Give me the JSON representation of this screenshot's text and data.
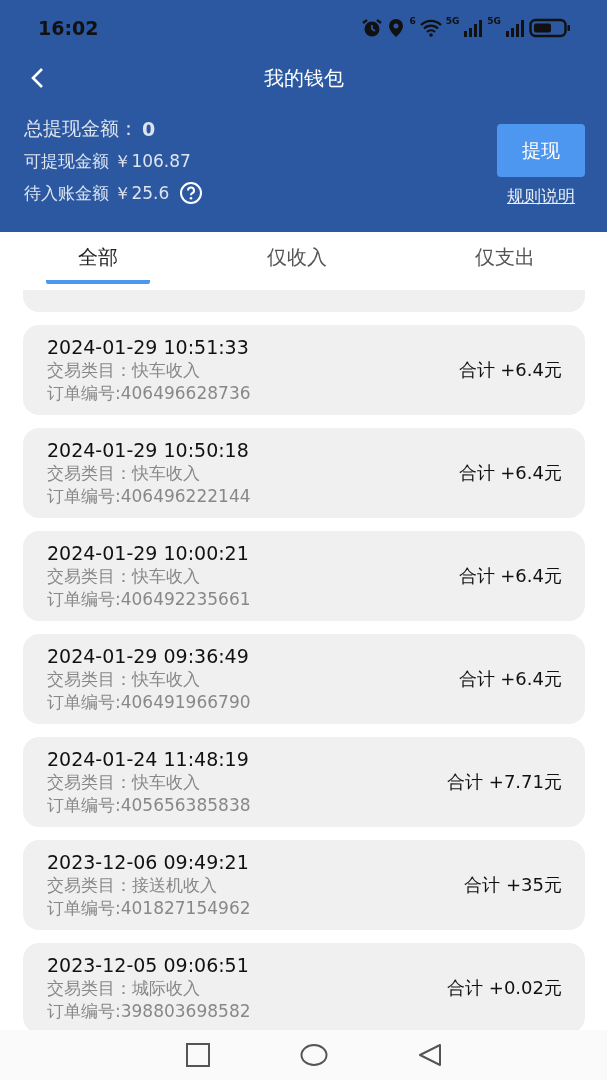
{
  "status_bar": {
    "time": "16:02",
    "wifi_label": "6",
    "sim1_label": "5G",
    "sim2_label": "5G"
  },
  "header": {
    "title": "我的钱包"
  },
  "summary": {
    "total_label": "总提现金额：",
    "total_value": "0",
    "available": "可提现金额 ￥106.87",
    "pending": "待入账金额 ￥25.6"
  },
  "withdraw_button": "提现",
  "rules_link": "规则说明",
  "tabs": [
    {
      "label": "全部",
      "selected": true
    },
    {
      "label": "仅收入",
      "selected": false
    },
    {
      "label": "仅支出",
      "selected": false
    }
  ],
  "transactions": [
    {
      "time": "2024-01-29 10:51:33",
      "category": "交易类目：快车收入",
      "order": "订单编号:406496628736",
      "total": "合计 +6.4元"
    },
    {
      "time": "2024-01-29 10:50:18",
      "category": "交易类目：快车收入",
      "order": "订单编号:406496222144",
      "total": "合计 +6.4元"
    },
    {
      "time": "2024-01-29 10:00:21",
      "category": "交易类目：快车收入",
      "order": "订单编号:406492235661",
      "total": "合计 +6.4元"
    },
    {
      "time": "2024-01-29 09:36:49",
      "category": "交易类目：快车收入",
      "order": "订单编号:406491966790",
      "total": "合计 +6.4元"
    },
    {
      "time": "2024-01-24 11:48:19",
      "category": "交易类目：快车收入",
      "order": "订单编号:405656385838",
      "total": "合计 +7.71元"
    },
    {
      "time": "2023-12-06 09:49:21",
      "category": "交易类目：接送机收入",
      "order": "订单编号:401827154962",
      "total": "合计 +35元"
    },
    {
      "time": "2023-12-05 09:06:51",
      "category": "交易类目：城际收入",
      "order": "订单编号:398803698582",
      "total": "合计 +0.02元"
    }
  ]
}
